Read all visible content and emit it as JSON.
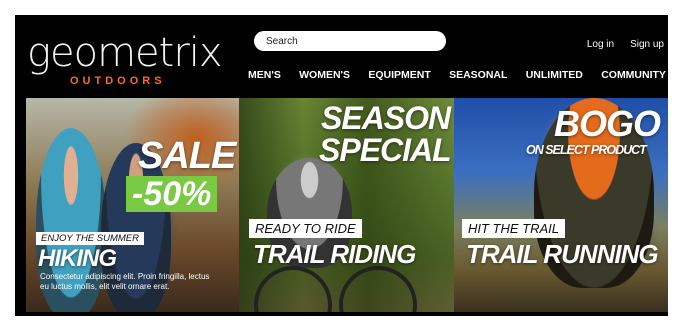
{
  "brand": {
    "name": "geometrix",
    "tagline": "OUTDOORS"
  },
  "search": {
    "placeholder": "Search"
  },
  "auth": {
    "login": "Log in",
    "signup": "Sign up"
  },
  "nav": [
    "MEN'S",
    "WOMEN'S",
    "EQUIPMENT",
    "SEASONAL",
    "UNLIMITED",
    "COMMUNITY"
  ],
  "panels": {
    "hiking": {
      "promo_line1": "SALE",
      "promo_line2": "-50%",
      "ribbon": "ENJOY THE SUMMER",
      "title": "HIKING",
      "description": "Consectetur adipiscing elit. Proin fringilla, lectus eu luctus mollis, elit velit ornare erat."
    },
    "trail_riding": {
      "promo_line1": "SEASON",
      "promo_line2": "SPECIAL",
      "ribbon": "READY TO RIDE",
      "title": "TRAIL RIDING"
    },
    "trail_running": {
      "promo_line1": "BOGO",
      "promo_line2": "ON SELECT PRODUCT",
      "ribbon": "HIT THE TRAIL",
      "title": "TRAIL RUNNING"
    }
  },
  "colors": {
    "accent": "#ff6a1a",
    "sale_green": "#7ac943",
    "background": "#000000"
  }
}
